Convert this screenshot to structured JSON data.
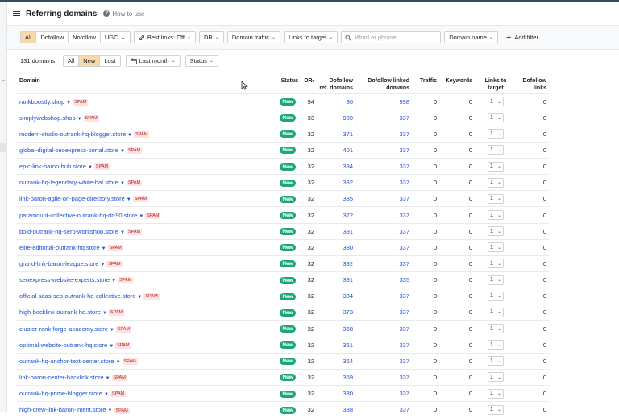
{
  "header": {
    "title": "Referring domains",
    "help_label": "How to use"
  },
  "filters": {
    "link_types": [
      {
        "label": "All",
        "active": true
      },
      {
        "label": "Dofollow",
        "active": false
      },
      {
        "label": "Nofollow",
        "active": false
      },
      {
        "label": "UGC",
        "active": false
      }
    ],
    "best_links": "Best links: Off",
    "dr": "DR",
    "domain_traffic": "Domain traffic",
    "links_to_target": "Links to target",
    "search_placeholder": "Word or phrase",
    "domain_name": "Domain name",
    "add_filter": "Add filter"
  },
  "toolbar": {
    "count": "131 domains",
    "tabs": [
      {
        "label": "All",
        "active": false
      },
      {
        "label": "New",
        "active": true
      },
      {
        "label": "Lost",
        "active": false
      }
    ],
    "period": "Last month",
    "status": "Status"
  },
  "table": {
    "columns": {
      "domain": "Domain",
      "status": "Status",
      "dr": "DR",
      "dofollow_ref": "Dofollow ref. domains",
      "dofollow_linked": "Dofollow linked domains",
      "traffic": "Traffic",
      "keywords": "Keywords",
      "links_to_target": "Links to target",
      "dofollow_links": "Dofollow links"
    },
    "status_label": "New",
    "spam_label": "SPAM",
    "rows": [
      {
        "domain": "rankboostly.shop",
        "dr": "54",
        "ref": "80",
        "linked": "998",
        "traffic": "0",
        "keywords": "0",
        "links": "1",
        "dofollow": "0"
      },
      {
        "domain": "simplywebshop.shop",
        "dr": "33",
        "ref": "989",
        "linked": "337",
        "traffic": "0",
        "keywords": "0",
        "links": "1",
        "dofollow": "0"
      },
      {
        "domain": "modern-studio-outrank-hq-blogger.store",
        "dr": "32",
        "ref": "371",
        "linked": "337",
        "traffic": "0",
        "keywords": "0",
        "links": "1",
        "dofollow": "0"
      },
      {
        "domain": "global-digital-seoexpress-portal.store",
        "dr": "32",
        "ref": "401",
        "linked": "337",
        "traffic": "0",
        "keywords": "0",
        "links": "1",
        "dofollow": "0"
      },
      {
        "domain": "epic-link-baron-hub.store",
        "dr": "32",
        "ref": "394",
        "linked": "337",
        "traffic": "0",
        "keywords": "0",
        "links": "1",
        "dofollow": "0"
      },
      {
        "domain": "outrank-hq-legendary-white-hat.store",
        "dr": "32",
        "ref": "382",
        "linked": "337",
        "traffic": "0",
        "keywords": "0",
        "links": "1",
        "dofollow": "0"
      },
      {
        "domain": "link-baron-agile-on-page-directory.store",
        "dr": "32",
        "ref": "385",
        "linked": "337",
        "traffic": "0",
        "keywords": "0",
        "links": "1",
        "dofollow": "0"
      },
      {
        "domain": "paramount-collective-outrank-hq-dr-90.store",
        "dr": "32",
        "ref": "372",
        "linked": "337",
        "traffic": "0",
        "keywords": "0",
        "links": "1",
        "dofollow": "0"
      },
      {
        "domain": "bold-outrank-hq-serp-workshop.store",
        "dr": "32",
        "ref": "391",
        "linked": "337",
        "traffic": "0",
        "keywords": "0",
        "links": "1",
        "dofollow": "0"
      },
      {
        "domain": "elite-editorial-outrank-hq.store",
        "dr": "32",
        "ref": "380",
        "linked": "337",
        "traffic": "0",
        "keywords": "0",
        "links": "1",
        "dofollow": "0"
      },
      {
        "domain": "grand-link-baron-league.store",
        "dr": "32",
        "ref": "392",
        "linked": "337",
        "traffic": "0",
        "keywords": "0",
        "links": "1",
        "dofollow": "0"
      },
      {
        "domain": "seoexpress-website-experts.store",
        "dr": "32",
        "ref": "391",
        "linked": "335",
        "traffic": "0",
        "keywords": "0",
        "links": "1",
        "dofollow": "0"
      },
      {
        "domain": "official-saas-seo-outrank-hq-collective.store",
        "dr": "32",
        "ref": "384",
        "linked": "337",
        "traffic": "0",
        "keywords": "0",
        "links": "1",
        "dofollow": "0"
      },
      {
        "domain": "high-backlink-outrank-hq.store",
        "dr": "32",
        "ref": "373",
        "linked": "337",
        "traffic": "0",
        "keywords": "0",
        "links": "1",
        "dofollow": "0"
      },
      {
        "domain": "cluster-rank-forge-academy.store",
        "dr": "32",
        "ref": "368",
        "linked": "337",
        "traffic": "0",
        "keywords": "0",
        "links": "1",
        "dofollow": "0"
      },
      {
        "domain": "optimal-website-outrank-hq.store",
        "dr": "32",
        "ref": "361",
        "linked": "337",
        "traffic": "0",
        "keywords": "0",
        "links": "1",
        "dofollow": "0"
      },
      {
        "domain": "outrank-hq-anchor-text-center.store",
        "dr": "32",
        "ref": "364",
        "linked": "337",
        "traffic": "0",
        "keywords": "0",
        "links": "1",
        "dofollow": "0"
      },
      {
        "domain": "link-baron-center-backlink.store",
        "dr": "32",
        "ref": "359",
        "linked": "337",
        "traffic": "0",
        "keywords": "0",
        "links": "1",
        "dofollow": "0"
      },
      {
        "domain": "outrank-hq-prime-blogger.store",
        "dr": "32",
        "ref": "380",
        "linked": "337",
        "traffic": "0",
        "keywords": "0",
        "links": "1",
        "dofollow": "0"
      },
      {
        "domain": "high-crew-link-baron-intent.store",
        "dr": "32",
        "ref": "388",
        "linked": "337",
        "traffic": "0",
        "keywords": "0",
        "links": "1",
        "dofollow": "0"
      }
    ]
  },
  "colors": {
    "accent": "#f9d9ac",
    "status_new": "#1ea672",
    "link": "#1d4ed8",
    "spam_bg": "#fde2e1",
    "spam_text": "#b91c1c"
  }
}
